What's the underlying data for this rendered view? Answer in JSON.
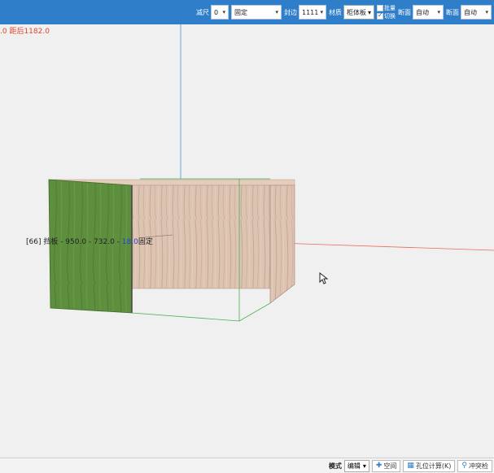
{
  "toolbar": {
    "field1": {
      "label": "减尺",
      "value": "0"
    },
    "field2": {
      "value": "固定"
    },
    "field3": {
      "label": "封边",
      "value": "1111"
    },
    "field4": {
      "label": "材质",
      "value": "柜体板"
    },
    "batch": {
      "line1": "批量",
      "line2": "切换",
      "checked_line2": true
    },
    "field5": {
      "label": "断面",
      "value": "自动"
    },
    "field6": {
      "label": "断面",
      "value": "自动"
    }
  },
  "viewport": {
    "distance_readout": ".0 距后1182.0",
    "dimension_label": {
      "prefix": "[66] 挡板 - 950.0 - 732.0 - ",
      "highlight": "18.0",
      "suffix": "固定"
    }
  },
  "statusbar": {
    "mode_label": "模式",
    "mode_value": "编辑",
    "space_button": "空间",
    "hole_calc_button": "孔位计算(K)",
    "center_button": "冲突检"
  },
  "colors": {
    "toolbar_bg": "#2f7ec9",
    "green_panel": "#5e8f3e",
    "wood_panel": "#d9bfae",
    "axis_red": "#e86a5a",
    "axis_blue": "#6aa8e0",
    "selection_green": "#4caf50"
  }
}
